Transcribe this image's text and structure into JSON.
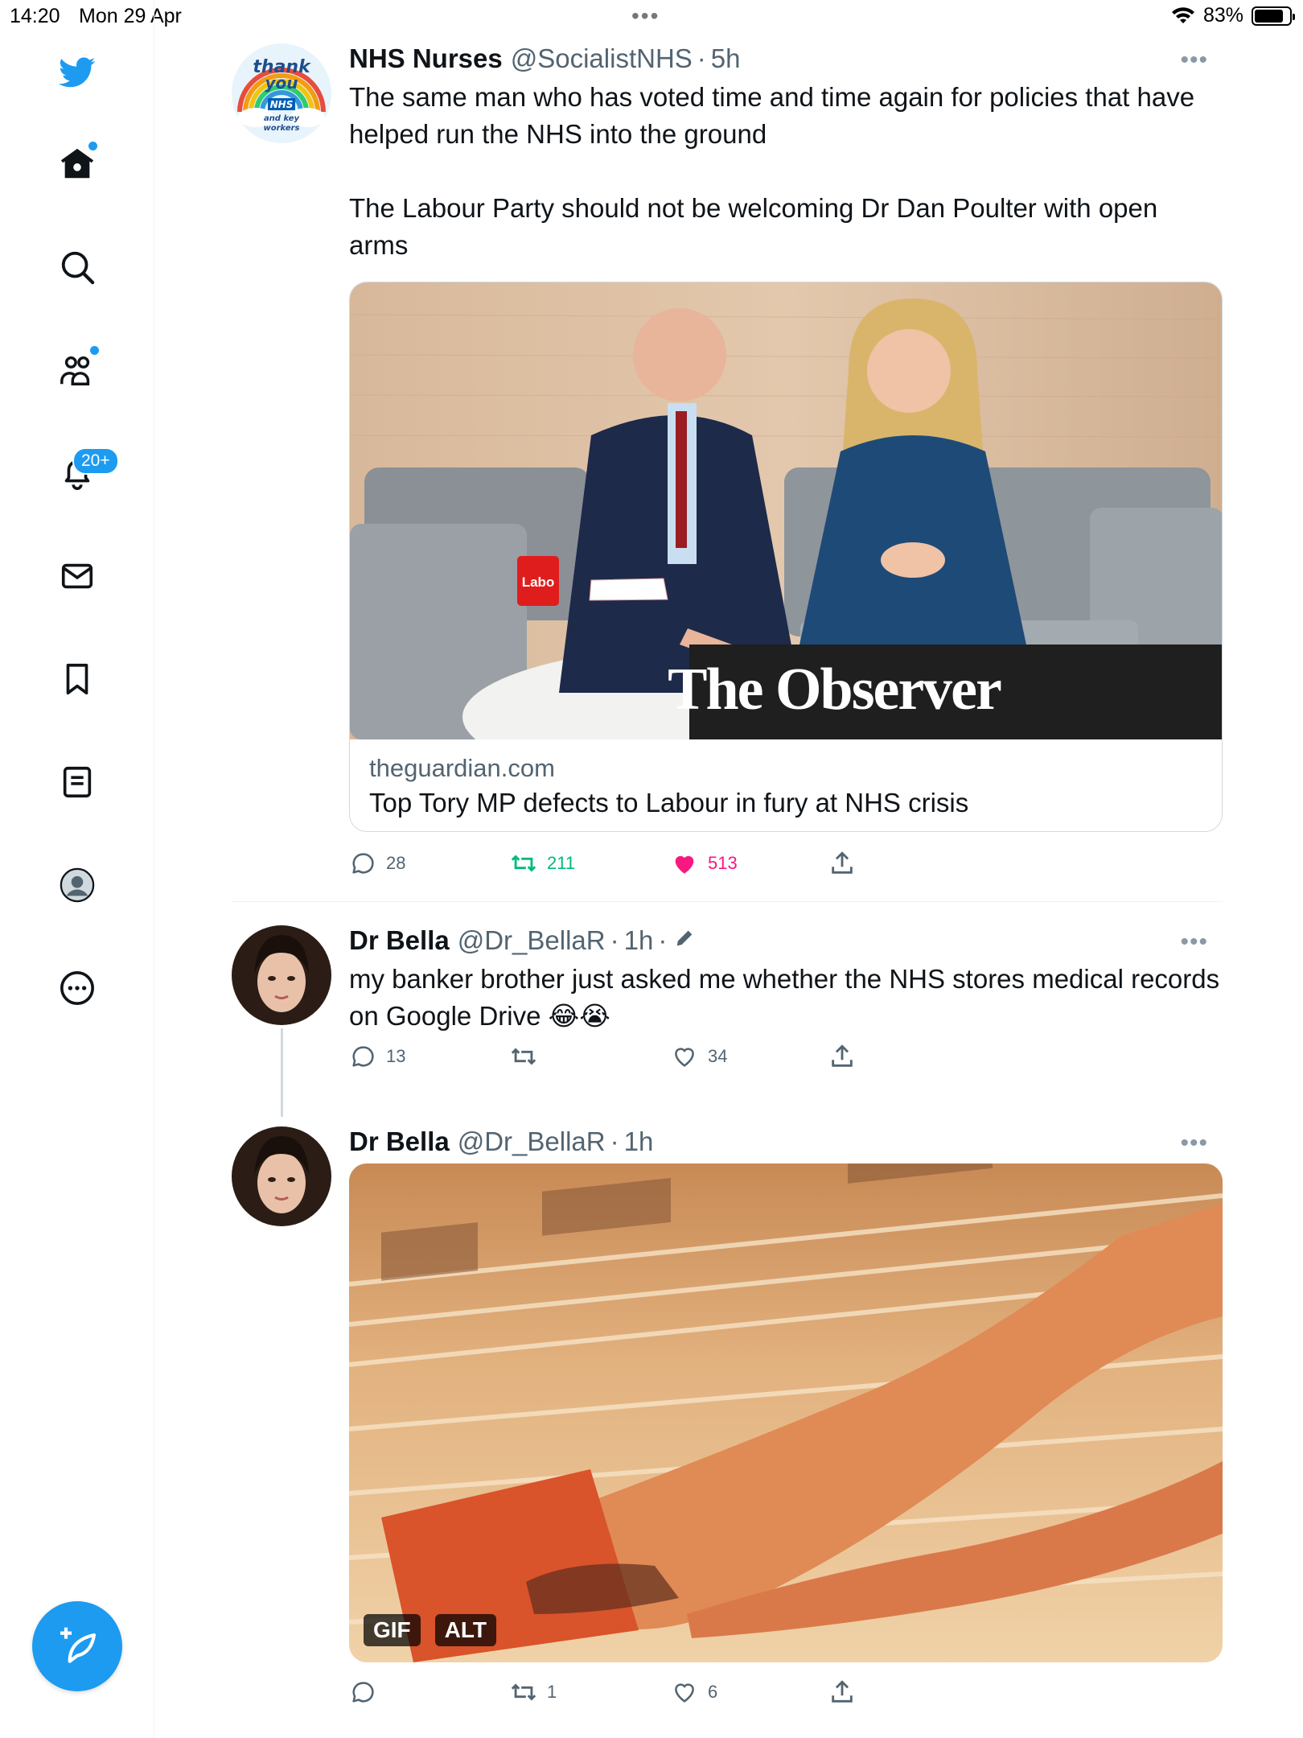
{
  "status_bar": {
    "time": "14:20",
    "date": "Mon 29 Apr",
    "battery": "83%",
    "battery_level": 0.83
  },
  "sidebar": {
    "items": [
      {
        "icon": "twitter-bird-icon"
      },
      {
        "icon": "home-icon",
        "has_dot": true
      },
      {
        "icon": "search-icon"
      },
      {
        "icon": "communities-icon",
        "has_dot": true
      },
      {
        "icon": "bell-icon",
        "badge": "20+"
      },
      {
        "icon": "mail-icon"
      },
      {
        "icon": "bookmark-icon"
      },
      {
        "icon": "lists-icon"
      },
      {
        "icon": "profile-icon"
      },
      {
        "icon": "more-circle-icon"
      }
    ],
    "notification_badge": "20+",
    "compose_icon": "compose-feather-icon"
  },
  "colors": {
    "accent": "#1d9bf0",
    "retweet_active": "#00ba7c",
    "like_active": "#f91880",
    "muted": "#536471"
  },
  "tweets": [
    {
      "name": "NHS Nurses",
      "handle": "@SocialistNHS",
      "time": "5h",
      "text_p1": "The same man who has voted time and time again for policies that have helped run the NHS into the ground",
      "text_p2": "The Labour Party should not be welcoming Dr Dan Poulter with open arms",
      "card": {
        "image_caption": "The Observer",
        "mug_text": "Labo",
        "domain": "theguardian.com",
        "title": "Top Tory MP defects to Labour in fury at NHS crisis"
      },
      "replies": "28",
      "retweets": "211",
      "likes": "513"
    },
    {
      "name": "Dr Bella",
      "handle": "@Dr_BellaR",
      "time": "1h",
      "text": "my banker brother just asked me whether the NHS stores medical records on Google Drive 😂😭",
      "replies": "13",
      "retweets": "",
      "likes": "34"
    },
    {
      "name": "Dr Bella",
      "handle": "@Dr_BellaR",
      "time": "1h",
      "gif_badge": "GIF",
      "alt_badge": "ALT",
      "replies": "",
      "retweets": "1",
      "likes": "6"
    }
  ],
  "avatar_logo": {
    "line1": "thank",
    "line2": "you",
    "line3": "NHS",
    "line4": "and key",
    "line5": "workers"
  }
}
